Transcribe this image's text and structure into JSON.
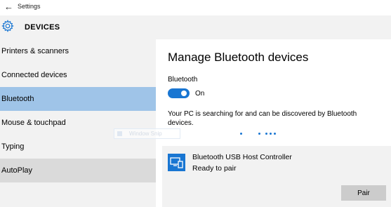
{
  "window": {
    "title": "Settings"
  },
  "header": {
    "title": "DEVICES"
  },
  "sidebar": {
    "items": [
      {
        "label": "Printers & scanners"
      },
      {
        "label": "Connected devices"
      },
      {
        "label": "Bluetooth"
      },
      {
        "label": "Mouse & touchpad"
      },
      {
        "label": "Typing"
      },
      {
        "label": "AutoPlay"
      }
    ]
  },
  "main": {
    "title": "Manage Bluetooth devices",
    "bluetooth_label": "Bluetooth",
    "toggle_state": "On",
    "searching_text": "Your PC is searching for and can be discovered by Bluetooth devices."
  },
  "device": {
    "name": "Bluetooth USB Host Controller",
    "status": "Ready to pair",
    "pair_label": "Pair",
    "icon": "computer-bluetooth-icon"
  },
  "overlay": {
    "text": "Window Snip"
  },
  "colors": {
    "accent": "#1976d2",
    "selected_nav": "#9fc4e8",
    "hover_nav": "#dadada",
    "panel_bg": "#f2f2f2"
  }
}
